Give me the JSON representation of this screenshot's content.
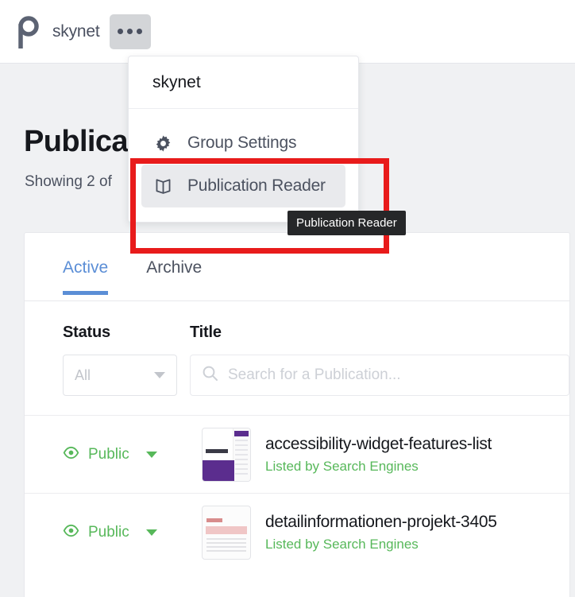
{
  "header": {
    "logo_name": "p-logo-icon",
    "group_name": "skynet",
    "kebab_label": "•••"
  },
  "page": {
    "title": "Publica",
    "subtitle": "Showing 2 of"
  },
  "dropdown": {
    "header_label": "skynet",
    "items": [
      {
        "label": "Group Settings",
        "icon": "gear-icon",
        "highlighted": false
      },
      {
        "label": "Publication Reader",
        "icon": "book-icon",
        "highlighted": true
      }
    ]
  },
  "tooltip": {
    "text": "Publication Reader"
  },
  "annotation": {
    "color": "#e81b1b"
  },
  "tabs": [
    {
      "label": "Active",
      "active": true
    },
    {
      "label": "Archive",
      "active": false
    }
  ],
  "filters": {
    "status": {
      "column_label": "Status",
      "value": "All"
    },
    "title": {
      "column_label": "Title",
      "placeholder": "Search for a Publication..."
    }
  },
  "publications": [
    {
      "status": "Public",
      "title": "accessibility-widget-features-list",
      "listing": "Listed by Search Engines",
      "thumb": "accessibility-thumbnail"
    },
    {
      "status": "Public",
      "title": "detailinformationen-projekt-3405",
      "listing": "Listed by Search Engines",
      "thumb": "detailinformationen-thumbnail"
    }
  ],
  "colors": {
    "accent_blue": "#5b8ed6",
    "status_green": "#57b85a",
    "annotation_red": "#e81b1b",
    "page_bg": "#f0f1f3"
  }
}
